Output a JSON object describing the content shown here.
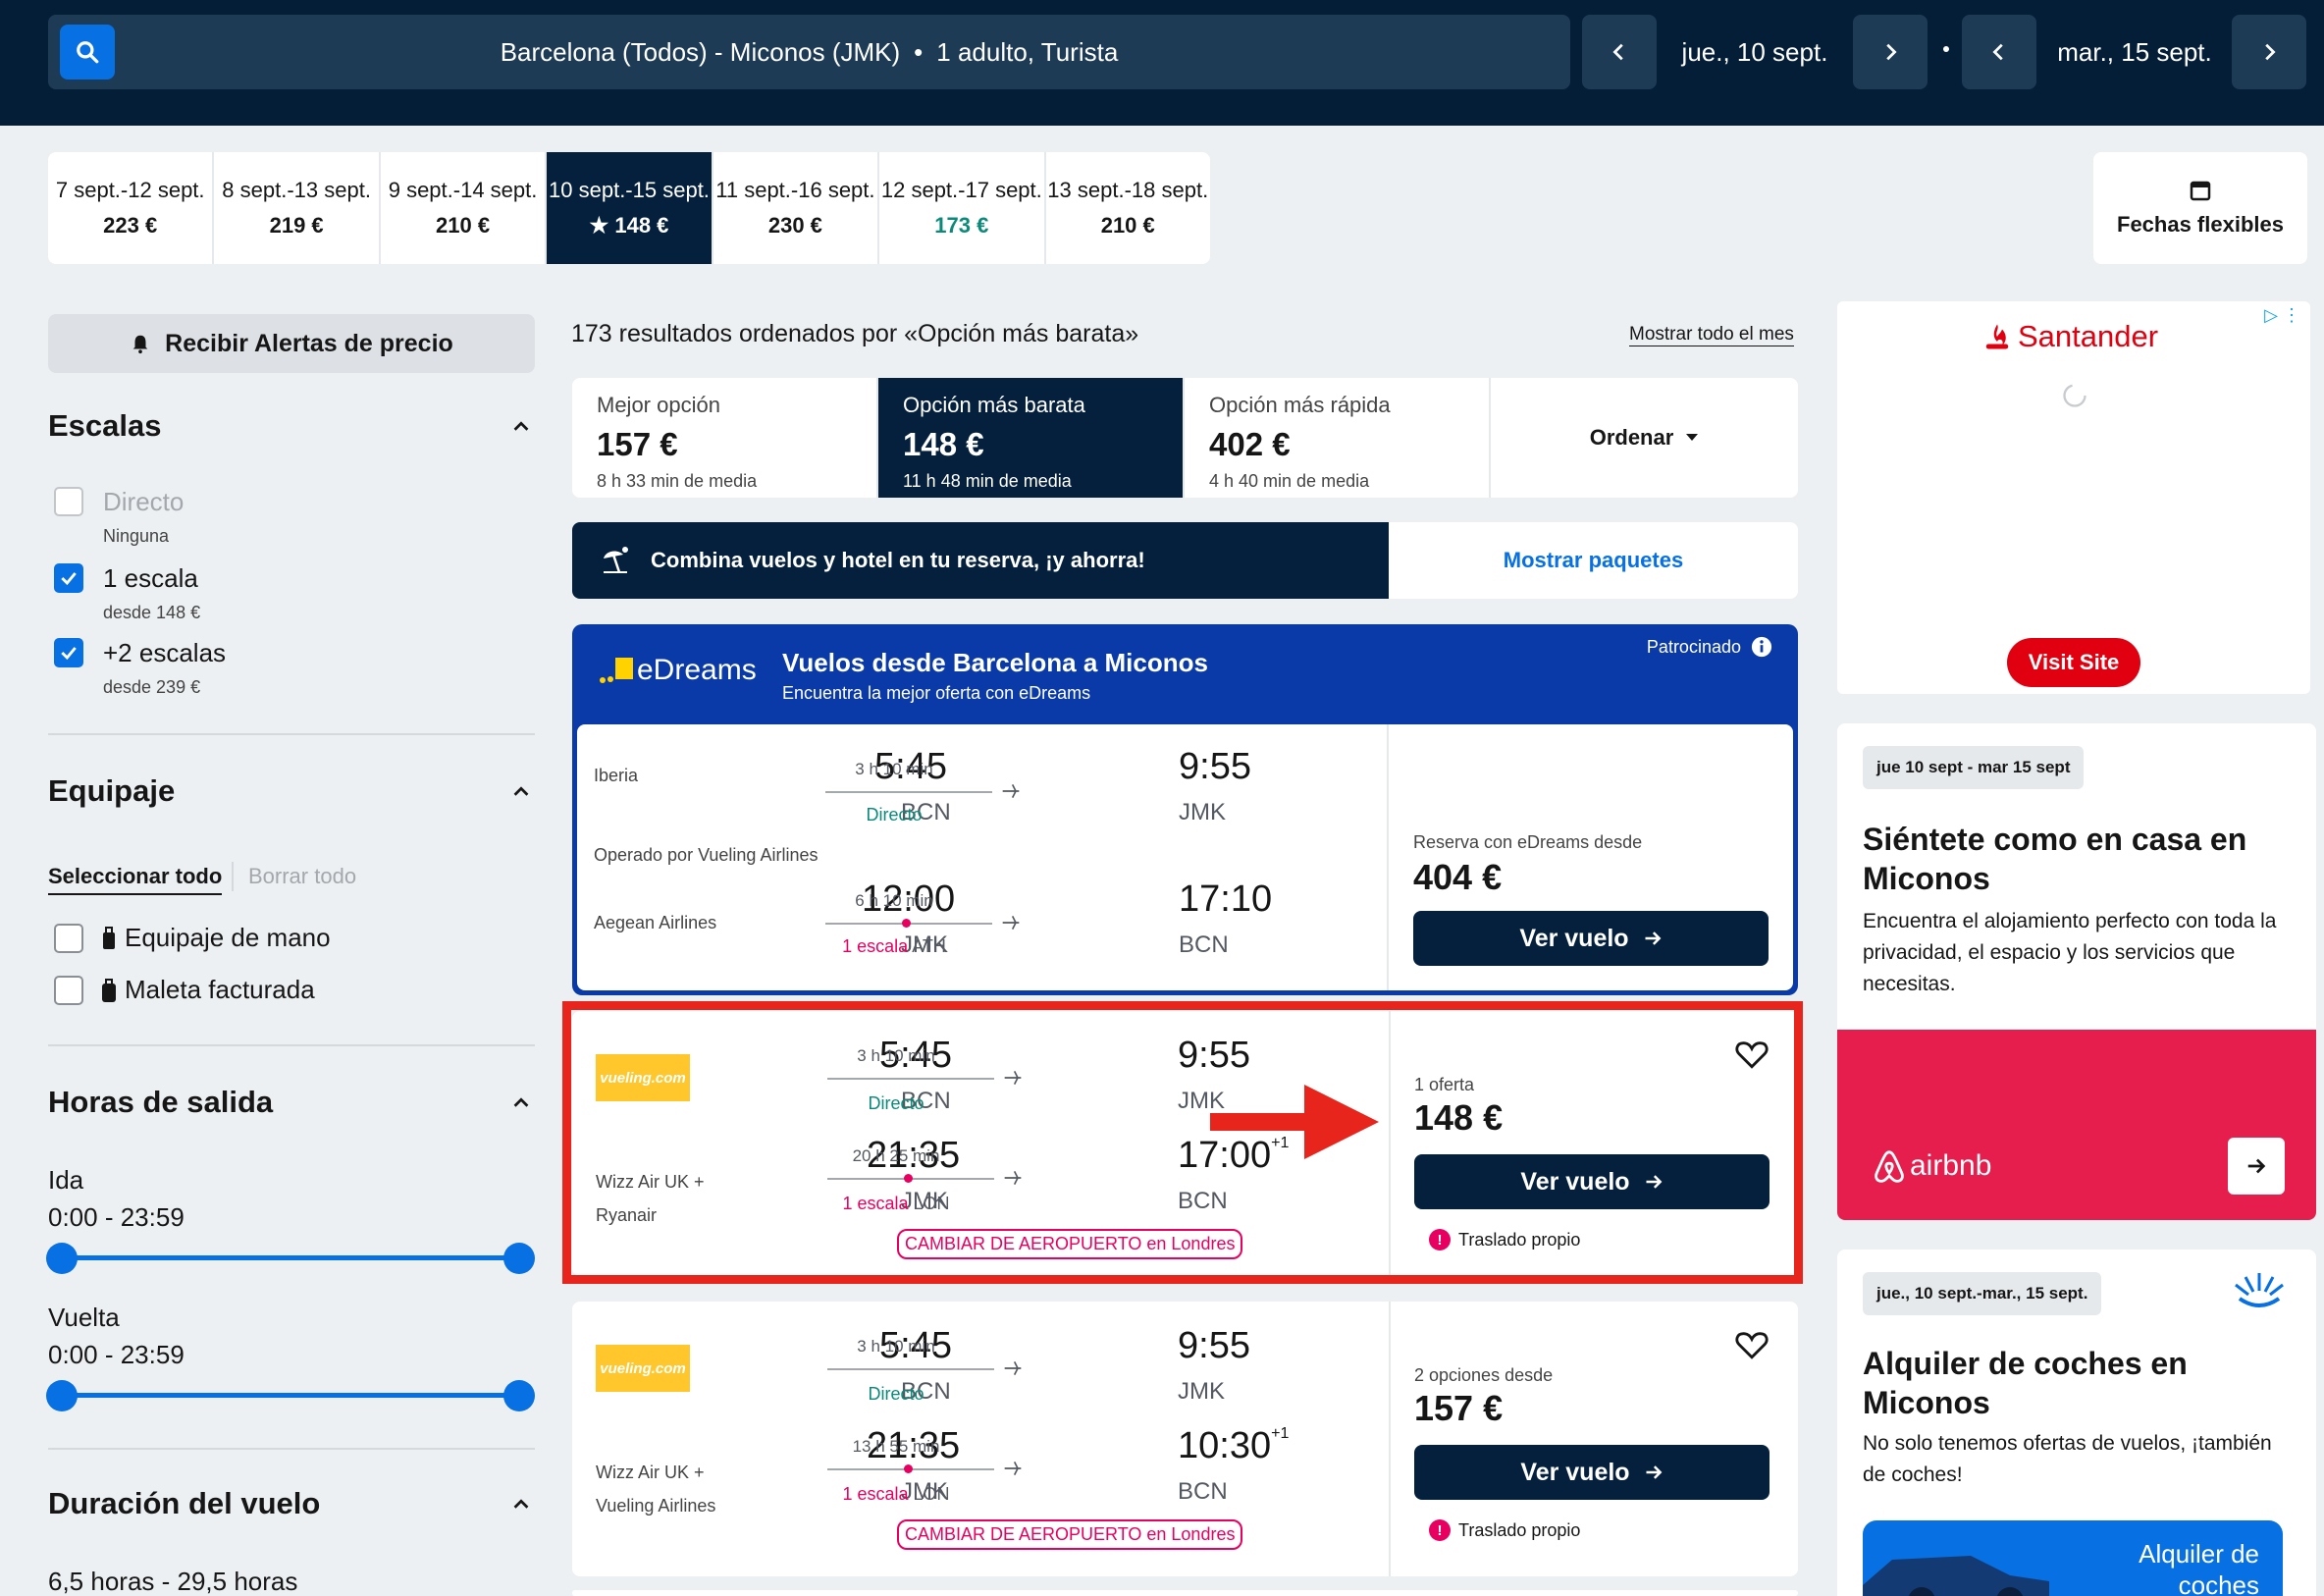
{
  "search": {
    "route": "Barcelona (Todos) - Miconos (JMK)",
    "passengers": "1 adulto, Turista",
    "depart_date": "jue., 10 sept.",
    "return_date": "mar., 15 sept."
  },
  "date_strip": [
    {
      "dates": "7 sept.-12 sept.",
      "price": "223 €"
    },
    {
      "dates": "8 sept.-13 sept.",
      "price": "219 €"
    },
    {
      "dates": "9 sept.-14 sept.",
      "price": "210 €"
    },
    {
      "dates": "10 sept.-15 sept.",
      "price": "★ 148 €"
    },
    {
      "dates": "11 sept.-16 sept.",
      "price": "230 €"
    },
    {
      "dates": "12 sept.-17 sept.",
      "price": "173 €"
    },
    {
      "dates": "13 sept.-18 sept.",
      "price": "210 €"
    }
  ],
  "flexible_dates": "Fechas flexibles",
  "sidebar": {
    "alerts": "Recibir Alertas de precio",
    "stops_title": "Escalas",
    "stops": [
      {
        "label": "Directo",
        "sub": "Ninguna",
        "checked": false
      },
      {
        "label": "1 escala",
        "sub": "desde 148 €",
        "checked": true
      },
      {
        "label": "+2 escalas",
        "sub": "desde 239 €",
        "checked": true
      }
    ],
    "baggage_title": "Equipaje",
    "select_all": "Seleccionar todo",
    "clear_all": "Borrar todo",
    "baggage": [
      "Equipaje de mano",
      "Maleta facturada"
    ],
    "departure_title": "Horas de salida",
    "outbound_label": "Ida",
    "outbound_range": "0:00 - 23:59",
    "return_label": "Vuelta",
    "return_range": "0:00 - 23:59",
    "duration_title": "Duración del vuelo",
    "duration_range": "6,5 horas - 29,5 horas"
  },
  "results": {
    "count": "173 resultados ordenados por «Opción más barata»",
    "show_month": "Mostrar todo el mes",
    "tabs": [
      {
        "title": "Mejor opción",
        "price": "157 €",
        "sub": "8 h 33 min de media"
      },
      {
        "title": "Opción más barata",
        "price": "148 €",
        "sub": "11 h 48 min de media"
      },
      {
        "title": "Opción más rápida",
        "price": "402 €",
        "sub": "4 h 40 min de media"
      }
    ],
    "order": "Ordenar",
    "promo": "Combina vuelos y hotel en tu reserva, ¡y ahorra!",
    "promo_link": "Mostrar paquetes"
  },
  "sponsored": {
    "brand": "eDreams",
    "title": "Vuelos desde Barcelona a Miconos",
    "subtitle": "Encuentra la mejor oferta con eDreams",
    "sponsored_label": "Patrocinado",
    "outbound": {
      "airline": "Iberia",
      "operated": "Operado por Vueling Airlines",
      "dep": "5:45",
      "dep_code": "BCN",
      "dur": "3 h 10 min",
      "stops": "Directo",
      "arr": "9:55",
      "arr_code": "JMK"
    },
    "inbound": {
      "airline": "Aegean Airlines",
      "dep": "12:00",
      "dep_code": "JMK",
      "dur": "6 h 10 min",
      "stops": "1 escala",
      "stop_ap": "ATH",
      "arr": "17:10",
      "arr_code": "BCN"
    },
    "price_label": "Reserva con eDreams desde",
    "price": "404 €",
    "button": "Ver vuelo"
  },
  "cards": [
    {
      "logo": "vueling.com",
      "inbound_airlines": [
        "Wizz Air UK +",
        "Ryanair"
      ],
      "out": {
        "dep": "5:45",
        "dep_code": "BCN",
        "dur": "3 h 10 min",
        "stops": "Directo",
        "arr": "9:55",
        "arr_code": "JMK"
      },
      "in": {
        "dep": "21:35",
        "dep_code": "JMK",
        "dur": "20 h 25 min",
        "stops": "1 escala",
        "stop_ap": "LON",
        "arr": "17:00",
        "plus": "+1",
        "arr_code": "BCN"
      },
      "warning": "CAMBIAR DE AEROPUERTO en Londres",
      "price_label": "1 oferta",
      "price": "148 €",
      "button": "Ver vuelo",
      "transfer": "Traslado propio"
    },
    {
      "logo": "vueling.com",
      "inbound_airlines": [
        "Wizz Air UK +",
        "Vueling Airlines"
      ],
      "out": {
        "dep": "5:45",
        "dep_code": "BCN",
        "dur": "3 h 10 min",
        "stops": "Directo",
        "arr": "9:55",
        "arr_code": "JMK"
      },
      "in": {
        "dep": "21:35",
        "dep_code": "JMK",
        "dur": "13 h 55 min",
        "stops": "1 escala",
        "stop_ap": "LON",
        "arr": "10:30",
        "plus": "+1",
        "arr_code": "BCN"
      },
      "warning": "CAMBIAR DE AEROPUERTO en Londres",
      "price_label": "2 opciones desde",
      "price": "157 €",
      "button": "Ver vuelo",
      "transfer": "Traslado propio"
    }
  ],
  "ads": {
    "santander": {
      "brand": "Santander",
      "button": "Visit Site"
    },
    "airbnb": {
      "dates": "jue 10 sept - mar 15 sept",
      "title": "Siéntete como en casa en Miconos",
      "text": "Encuentra el alojamiento perfecto con toda la privacidad, el espacio y los servicios que necesitas.",
      "brand": "airbnb"
    },
    "cars": {
      "dates": "jue., 10 sept.-mar., 15 sept.",
      "title": "Alquiler de coches en Miconos",
      "text": "No solo tenemos ofertas de vuelos, ¡también de coches!",
      "box": "Alquiler de coches"
    }
  },
  "colors": {
    "navy": "#05203c",
    "blue": "#0770e3",
    "pink": "#e7005f",
    "highlight": "#e8251c"
  }
}
